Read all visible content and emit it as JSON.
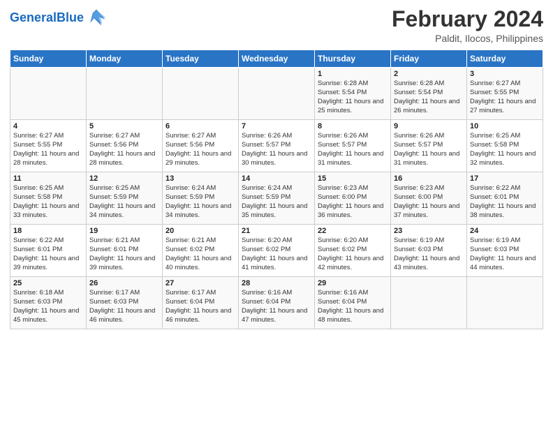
{
  "header": {
    "logo_general": "General",
    "logo_blue": "Blue",
    "month_year": "February 2024",
    "location": "Paldit, Ilocos, Philippines"
  },
  "days_of_week": [
    "Sunday",
    "Monday",
    "Tuesday",
    "Wednesday",
    "Thursday",
    "Friday",
    "Saturday"
  ],
  "weeks": [
    [
      {
        "day": "",
        "info": ""
      },
      {
        "day": "",
        "info": ""
      },
      {
        "day": "",
        "info": ""
      },
      {
        "day": "",
        "info": ""
      },
      {
        "day": "1",
        "info": "Sunrise: 6:28 AM\nSunset: 5:54 PM\nDaylight: 11 hours and 25 minutes."
      },
      {
        "day": "2",
        "info": "Sunrise: 6:28 AM\nSunset: 5:54 PM\nDaylight: 11 hours and 26 minutes."
      },
      {
        "day": "3",
        "info": "Sunrise: 6:27 AM\nSunset: 5:55 PM\nDaylight: 11 hours and 27 minutes."
      }
    ],
    [
      {
        "day": "4",
        "info": "Sunrise: 6:27 AM\nSunset: 5:55 PM\nDaylight: 11 hours and 28 minutes."
      },
      {
        "day": "5",
        "info": "Sunrise: 6:27 AM\nSunset: 5:56 PM\nDaylight: 11 hours and 28 minutes."
      },
      {
        "day": "6",
        "info": "Sunrise: 6:27 AM\nSunset: 5:56 PM\nDaylight: 11 hours and 29 minutes."
      },
      {
        "day": "7",
        "info": "Sunrise: 6:26 AM\nSunset: 5:57 PM\nDaylight: 11 hours and 30 minutes."
      },
      {
        "day": "8",
        "info": "Sunrise: 6:26 AM\nSunset: 5:57 PM\nDaylight: 11 hours and 31 minutes."
      },
      {
        "day": "9",
        "info": "Sunrise: 6:26 AM\nSunset: 5:57 PM\nDaylight: 11 hours and 31 minutes."
      },
      {
        "day": "10",
        "info": "Sunrise: 6:25 AM\nSunset: 5:58 PM\nDaylight: 11 hours and 32 minutes."
      }
    ],
    [
      {
        "day": "11",
        "info": "Sunrise: 6:25 AM\nSunset: 5:58 PM\nDaylight: 11 hours and 33 minutes."
      },
      {
        "day": "12",
        "info": "Sunrise: 6:25 AM\nSunset: 5:59 PM\nDaylight: 11 hours and 34 minutes."
      },
      {
        "day": "13",
        "info": "Sunrise: 6:24 AM\nSunset: 5:59 PM\nDaylight: 11 hours and 34 minutes."
      },
      {
        "day": "14",
        "info": "Sunrise: 6:24 AM\nSunset: 5:59 PM\nDaylight: 11 hours and 35 minutes."
      },
      {
        "day": "15",
        "info": "Sunrise: 6:23 AM\nSunset: 6:00 PM\nDaylight: 11 hours and 36 minutes."
      },
      {
        "day": "16",
        "info": "Sunrise: 6:23 AM\nSunset: 6:00 PM\nDaylight: 11 hours and 37 minutes."
      },
      {
        "day": "17",
        "info": "Sunrise: 6:22 AM\nSunset: 6:01 PM\nDaylight: 11 hours and 38 minutes."
      }
    ],
    [
      {
        "day": "18",
        "info": "Sunrise: 6:22 AM\nSunset: 6:01 PM\nDaylight: 11 hours and 39 minutes."
      },
      {
        "day": "19",
        "info": "Sunrise: 6:21 AM\nSunset: 6:01 PM\nDaylight: 11 hours and 39 minutes."
      },
      {
        "day": "20",
        "info": "Sunrise: 6:21 AM\nSunset: 6:02 PM\nDaylight: 11 hours and 40 minutes."
      },
      {
        "day": "21",
        "info": "Sunrise: 6:20 AM\nSunset: 6:02 PM\nDaylight: 11 hours and 41 minutes."
      },
      {
        "day": "22",
        "info": "Sunrise: 6:20 AM\nSunset: 6:02 PM\nDaylight: 11 hours and 42 minutes."
      },
      {
        "day": "23",
        "info": "Sunrise: 6:19 AM\nSunset: 6:03 PM\nDaylight: 11 hours and 43 minutes."
      },
      {
        "day": "24",
        "info": "Sunrise: 6:19 AM\nSunset: 6:03 PM\nDaylight: 11 hours and 44 minutes."
      }
    ],
    [
      {
        "day": "25",
        "info": "Sunrise: 6:18 AM\nSunset: 6:03 PM\nDaylight: 11 hours and 45 minutes."
      },
      {
        "day": "26",
        "info": "Sunrise: 6:17 AM\nSunset: 6:03 PM\nDaylight: 11 hours and 46 minutes."
      },
      {
        "day": "27",
        "info": "Sunrise: 6:17 AM\nSunset: 6:04 PM\nDaylight: 11 hours and 46 minutes."
      },
      {
        "day": "28",
        "info": "Sunrise: 6:16 AM\nSunset: 6:04 PM\nDaylight: 11 hours and 47 minutes."
      },
      {
        "day": "29",
        "info": "Sunrise: 6:16 AM\nSunset: 6:04 PM\nDaylight: 11 hours and 48 minutes."
      },
      {
        "day": "",
        "info": ""
      },
      {
        "day": "",
        "info": ""
      }
    ]
  ]
}
